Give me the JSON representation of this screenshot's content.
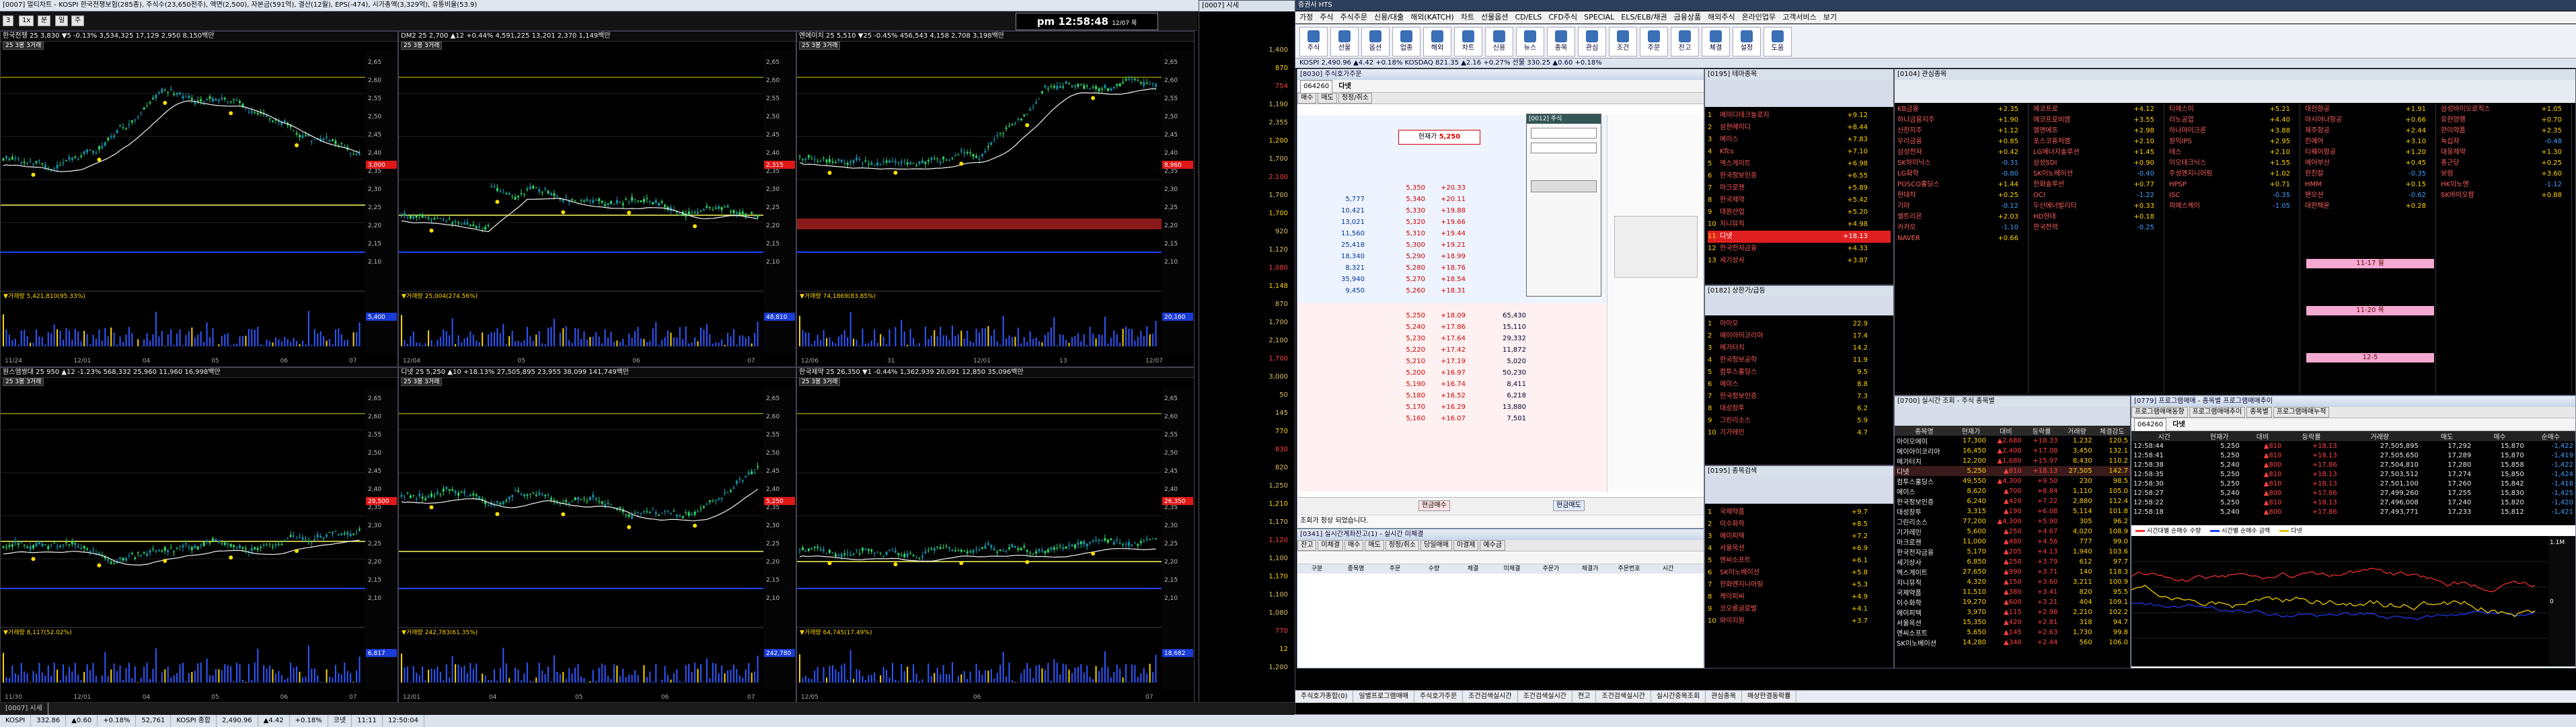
{
  "left_window": {
    "title": "[0007] 멀티차트 - KOSPI 한국전쟁보험(285종), 주식수(23,650천주), 액면(2,500), 자본금(591억), 결산(12월), EPS(-474), 시가총액(3,329억), 유통비율(53.9)",
    "clock": "pm 12:58:48",
    "clock_date": "12/07 목",
    "charts": [
      {
        "head": "한국전쟁 25  3,830  ▼5  -0.13%  3,534,325 17,129 2,950 8,150백만",
        "mode": "25  3봉  3거래",
        "price_tag": "3,000",
        "vol_label": "▼거래량 5,421,810(95.33%)",
        "vol_tag": "5,400",
        "dates": [
          "11/24",
          "12/01",
          "04",
          "05",
          "06",
          "07"
        ]
      },
      {
        "head": "DM2 25  2,700  ▲12  +0.44%  4,591,225 13,201 2,370 1,149백만",
        "mode": "25  3봉  3거래",
        "price_tag": "2,315",
        "vol_label": "▼거래량 25,004(274.56%)",
        "vol_tag": "48,810",
        "dates": [
          "12/04",
          "05",
          "06",
          "07"
        ]
      },
      {
        "head": "엔에이치 25  5,510  ▼25  -0.45%  456,543 4,158 2,708 3,198백만",
        "mode": "25  3봉  3거래",
        "price_tag": "8,960",
        "vol_label": "▼거래량 74,1869(83.85%)",
        "vol_tag": "20,160",
        "dates": [
          "12/06",
          "31",
          "12/01",
          "13",
          "12/07"
        ]
      },
      {
        "head": "원스엠쌍대 25  950  ▲12  -1.23%  568,332 25,960 11,960 16,998백만",
        "mode": "25  3봉  3거래",
        "price_tag": "29,500",
        "vol_label": "▼거래량 8,117(52.02%)",
        "vol_tag": "6,817",
        "dates": [
          "11/30",
          "12/01",
          "04",
          "05",
          "06",
          "07"
        ]
      },
      {
        "head": "디넷 25  5,250  ▲10  +18.13%  27,505,895 23,955 38,099 141,749백만",
        "mode": "25  3봉  3거래",
        "price_tag": "5,250",
        "vol_label": "▼거래량 242,783(61.35%)",
        "vol_tag": "242,780",
        "dates": [
          "12/01",
          "04",
          "05",
          "06",
          "07"
        ]
      },
      {
        "head": "한국제약 25  26,350  ▼1  -0.44%  1,362,939 20,091 12,850 35,096백만",
        "mode": "25  3봉  3거래",
        "price_tag": "26,350",
        "vol_label": "▼거래량 64,745(17.49%)",
        "vol_tag": "18,682",
        "dates": [
          "12/05",
          "06",
          "07"
        ]
      }
    ]
  },
  "narrow_column": {
    "header": "[0007] 시세",
    "values": [
      "1,400",
      "870",
      "754",
      "1,190",
      "2,355",
      "1,200",
      "1,700",
      "2,100",
      "1,700",
      "1,700",
      "920",
      "1,120",
      "1,080",
      "1,148",
      "870",
      "1,700",
      "2,100",
      "1,700",
      "3,000",
      "50",
      "145",
      "770",
      "830",
      "820",
      "1,250",
      "1,210",
      "1,170",
      "1,120",
      "1,100",
      "1,170",
      "1,100",
      "1,080",
      "770",
      "12",
      "1,200"
    ]
  },
  "main_app": {
    "title": "증권사 HTS",
    "menu": [
      "가정",
      "주식",
      "주식주문",
      "신용/대출",
      "해외(KATCH)",
      "차트",
      "선물옵션",
      "CD/ELS",
      "CFD주식",
      "SPECIAL",
      "ELS/ELB/채권",
      "금융상품",
      "해외주식",
      "온라인업무",
      "고객서비스",
      "보기"
    ],
    "toolbar": [
      "주식",
      "선물",
      "옵션",
      "업종",
      "해외",
      "차트",
      "신용",
      "뉴스",
      "종목",
      "관심",
      "조건",
      "주문",
      "잔고",
      "체결",
      "설정",
      "도움"
    ],
    "ticker": "KOSPI 2,490.96 ▲4.42 +0.18%   KOSDAQ 821.35 ▲2.16 +0.27%   선물 330.25 ▲0.60 +0.18%"
  },
  "order_window": {
    "title": "[8030] 주식호가주문",
    "code": "064260",
    "name": "다넷",
    "tabs": [
      "매수",
      "매도",
      "정정/취소"
    ],
    "price_label": "현재가",
    "current_price": "5,250",
    "asks": [
      {
        "qty": "",
        "price": "5,350",
        "pct": "+20.33"
      },
      {
        "qty": "5,777",
        "price": "5,340",
        "pct": "+20.11"
      },
      {
        "qty": "10,421",
        "price": "5,330",
        "pct": "+19.88"
      },
      {
        "qty": "13,021",
        "price": "5,320",
        "pct": "+19.66"
      },
      {
        "qty": "11,560",
        "price": "5,310",
        "pct": "+19.44"
      },
      {
        "qty": "25,418",
        "price": "5,300",
        "pct": "+19.21"
      },
      {
        "qty": "18,340",
        "price": "5,290",
        "pct": "+18.99"
      },
      {
        "qty": "8,321",
        "price": "5,280",
        "pct": "+18.76"
      },
      {
        "qty": "35,940",
        "price": "5,270",
        "pct": "+18.54"
      },
      {
        "qty": "9,450",
        "price": "5,260",
        "pct": "+18.31"
      }
    ],
    "bids": [
      {
        "price": "5,250",
        "pct": "+18.09",
        "qty": "65,430"
      },
      {
        "price": "5,240",
        "pct": "+17.86",
        "qty": "15,110"
      },
      {
        "price": "5,230",
        "pct": "+17.64",
        "qty": "29,332"
      },
      {
        "price": "5,220",
        "pct": "+17.42",
        "qty": "11,872"
      },
      {
        "price": "5,210",
        "pct": "+17.19",
        "qty": "5,020"
      },
      {
        "price": "5,200",
        "pct": "+16.97",
        "qty": "50,230"
      },
      {
        "price": "5,190",
        "pct": "+16.74",
        "qty": "8,411"
      },
      {
        "price": "5,180",
        "pct": "+16.52",
        "qty": "6,218"
      },
      {
        "price": "5,170",
        "pct": "+16.29",
        "qty": "13,880"
      },
      {
        "price": "5,160",
        "pct": "+16.07",
        "qty": "7,501"
      }
    ],
    "bottom_label": "조회가 정상 되었습니다.",
    "buy_btn": "현금매수",
    "sell_btn": "현금매도"
  },
  "realtime_window": {
    "title": "[0341] 실시간계좌잔고(1) - 실시간 미체결",
    "tabs": [
      "잔고",
      "미체결",
      "매수",
      "매도",
      "정정/취소",
      "당일매매",
      "미결제",
      "예수금"
    ],
    "cols": [
      "구분",
      "종목명",
      "주문",
      "수량",
      "체결",
      "미체결",
      "주문가",
      "체결가",
      "주문번호",
      "시간"
    ]
  },
  "themes": {
    "title": "[0195] 테마종목",
    "items": [
      {
        "name": "에이디테크놀로지",
        "chg": "+9.12"
      },
      {
        "name": "삼현에이디",
        "chg": "+8.44"
      },
      {
        "name": "에이스",
        "chg": "+7.83"
      },
      {
        "name": "KTcs",
        "chg": "+7.10"
      },
      {
        "name": "엑스게이트",
        "chg": "+6.98"
      },
      {
        "name": "한국정보인증",
        "chg": "+6.55"
      },
      {
        "name": "마크로젠",
        "chg": "+5.89"
      },
      {
        "name": "한국제약",
        "chg": "+5.42"
      },
      {
        "name": "대원산업",
        "chg": "+5.20"
      },
      {
        "name": "지니뮤직",
        "chg": "+4.98"
      },
      {
        "name": "디넷",
        "chg": "+18.13"
      },
      {
        "name": "한국전자금융",
        "chg": "+4.33"
      },
      {
        "name": "세기상사",
        "chg": "+3.87"
      }
    ]
  },
  "upper_list": {
    "title": "[0182] 상한가/급등",
    "items": [
      {
        "name": "아이오",
        "chg": "22.9"
      },
      {
        "name": "에이아이코리아",
        "chg": "17.4"
      },
      {
        "name": "메가터치",
        "chg": "14.2"
      },
      {
        "name": "한국정보공학",
        "chg": "11.9"
      },
      {
        "name": "컴투스홀딩스",
        "chg": "9.5"
      },
      {
        "name": "에이스",
        "chg": "8.8"
      },
      {
        "name": "한국정보인증",
        "chg": "7.3"
      },
      {
        "name": "대성창투",
        "chg": "6.2"
      },
      {
        "name": "그린리소스",
        "chg": "5.9"
      },
      {
        "name": "기가레인",
        "chg": "4.7"
      }
    ]
  },
  "mini_list": {
    "title": "[0195] 종목검색",
    "items": [
      {
        "name": "국제약품",
        "chg": "+9.7"
      },
      {
        "name": "이수화학",
        "chg": "+8.5"
      },
      {
        "name": "에이피텍",
        "chg": "+7.2"
      },
      {
        "name": "서울옥션",
        "chg": "+6.9"
      },
      {
        "name": "엔씨소프트",
        "chg": "+6.1"
      },
      {
        "name": "SK이노베이션",
        "chg": "+5.8"
      },
      {
        "name": "한화엔지니어링",
        "chg": "+5.3"
      },
      {
        "name": "케이피씨",
        "chg": "+4.9"
      },
      {
        "name": "코오롱글로벌",
        "chg": "+4.1"
      },
      {
        "name": "와이지원",
        "chg": "+3.7"
      }
    ]
  },
  "quote_board": {
    "title": "[0104] 관심종목",
    "columns": [
      {
        "items": [
          "KB금융",
          "하나금융지주",
          "신한지주",
          "우리금융",
          "삼성전자",
          "SK하이닉스",
          "LG화학",
          "POSCO홀딩스",
          "현대차",
          "기아",
          "셀트리온",
          "카카오",
          "NAVER"
        ],
        "vals": [
          "+2.35",
          "+1.90",
          "+1.12",
          "+0.85",
          "+0.42",
          "-0.31",
          "-0.80",
          "+1.44",
          "+0.25",
          "-0.12",
          "+2.03",
          "-1.10",
          "+0.66"
        ]
      },
      {
        "items": [
          "에코프로",
          "에코프로비엠",
          "엘앤에프",
          "포스코퓨처엠",
          "LG에너지솔루션",
          "삼성SDI",
          "SK이노베이션",
          "한화솔루션",
          "OCI",
          "두산에너빌리티",
          "HD현대",
          "한국전력"
        ],
        "vals": [
          "+4.12",
          "+3.55",
          "+2.98",
          "+2.10",
          "+1.45",
          "+0.90",
          "-0.40",
          "+0.77",
          "-1.22",
          "+0.33",
          "+0.18",
          "-0.25"
        ]
      },
      {
        "items": [
          "티에스이",
          "리노공업",
          "하나마이크론",
          "원익IPS",
          "테스",
          "이오테크닉스",
          "주성엔지니어링",
          "HPSP",
          "ISC",
          "피에스케이"
        ],
        "vals": [
          "+5.21",
          "+4.40",
          "+3.88",
          "+2.95",
          "+2.10",
          "+1.55",
          "+1.02",
          "+0.71",
          "-0.35",
          "-1.05"
        ]
      },
      {
        "items": [
          "대한항공",
          "아시아나항공",
          "제주항공",
          "진에어",
          "티웨이항공",
          "에어부산",
          "한진칼",
          "HMM",
          "팬오션",
          "대한해운"
        ],
        "vals": [
          "+1.91",
          "+0.66",
          "+2.44",
          "+3.10",
          "+1.20",
          "+0.45",
          "-0.35",
          "+0.15",
          "-0.62",
          "+0.28"
        ]
      },
      {
        "items": [
          "삼성바이오로직스",
          "유한양행",
          "한미약품",
          "녹십자",
          "대웅제약",
          "종근당",
          "보령",
          "HK이노엔",
          "SK바이오팜"
        ],
        "vals": [
          "+1.05",
          "+0.70",
          "+2.35",
          "-0.48",
          "+1.30",
          "+0.25",
          "+3.60",
          "-1.12",
          "+0.88"
        ]
      }
    ],
    "highlight_labels": [
      "11-17 월",
      "11-20 목",
      "12-5"
    ]
  },
  "program_table": {
    "title": "[0700] 실시간 조회 - 주식 종목별",
    "headers": [
      "종목명",
      "현재가",
      "대비",
      "등락률",
      "거래량",
      "체결강도"
    ],
    "rows": [
      {
        "name": "아이오에이",
        "price": "17,300",
        "chg": "▲2,680",
        "rate": "+18.33",
        "vol": "1,232",
        "str": "120.5"
      },
      {
        "name": "에이아이코리아",
        "price": "16,450",
        "chg": "▲2,400",
        "rate": "+17.08",
        "vol": "3,450",
        "str": "132.1"
      },
      {
        "name": "메가터치",
        "price": "12,200",
        "chg": "▲1,680",
        "rate": "+15.97",
        "vol": "8,430",
        "str": "110.2"
      },
      {
        "name": "디넷",
        "price": "5,250",
        "chg": "▲810",
        "rate": "+18.13",
        "vol": "27,505",
        "str": "142.7"
      },
      {
        "name": "컴투스홀딩스",
        "price": "49,550",
        "chg": "▲4,300",
        "rate": "+9.50",
        "vol": "230",
        "str": "98.5"
      },
      {
        "name": "에이스",
        "price": "8,620",
        "chg": "▲700",
        "rate": "+8.84",
        "vol": "1,110",
        "str": "105.0"
      },
      {
        "name": "한국정보인증",
        "price": "6,240",
        "chg": "▲420",
        "rate": "+7.22",
        "vol": "2,880",
        "str": "112.4"
      },
      {
        "name": "대성창투",
        "price": "3,315",
        "chg": "▲190",
        "rate": "+6.08",
        "vol": "5,114",
        "str": "101.8"
      },
      {
        "name": "그린리소스",
        "price": "77,200",
        "chg": "▲4,300",
        "rate": "+5.90",
        "vol": "305",
        "str": "96.2"
      },
      {
        "name": "기가레인",
        "price": "5,600",
        "chg": "▲250",
        "rate": "+4.67",
        "vol": "4,020",
        "str": "108.9"
      },
      {
        "name": "마크로젠",
        "price": "11,000",
        "chg": "▲480",
        "rate": "+4.56",
        "vol": "777",
        "str": "99.0"
      },
      {
        "name": "한국전자금융",
        "price": "5,170",
        "chg": "▲205",
        "rate": "+4.13",
        "vol": "1,940",
        "str": "103.6"
      },
      {
        "name": "세기상사",
        "price": "6,850",
        "chg": "▲250",
        "rate": "+3.79",
        "vol": "612",
        "str": "97.7"
      },
      {
        "name": "엑스게이트",
        "price": "27,650",
        "chg": "▲990",
        "rate": "+3.71",
        "vol": "140",
        "str": "118.3"
      },
      {
        "name": "지니뮤직",
        "price": "4,320",
        "chg": "▲150",
        "rate": "+3.60",
        "vol": "3,211",
        "str": "100.9"
      },
      {
        "name": "국제약품",
        "price": "11,510",
        "chg": "▲380",
        "rate": "+3.41",
        "vol": "820",
        "str": "95.5"
      },
      {
        "name": "이수화학",
        "price": "19,270",
        "chg": "▲600",
        "rate": "+3.21",
        "vol": "404",
        "str": "109.1"
      },
      {
        "name": "에이피텍",
        "price": "3,970",
        "chg": "▲115",
        "rate": "+2.98",
        "vol": "2,210",
        "str": "102.2"
      },
      {
        "name": "서울옥션",
        "price": "15,350",
        "chg": "▲420",
        "rate": "+2.81",
        "vol": "318",
        "str": "94.7"
      },
      {
        "name": "엔씨소프트",
        "price": "5,650",
        "chg": "▲145",
        "rate": "+2.63",
        "vol": "1,730",
        "str": "99.8"
      },
      {
        "name": "SK이노베이션",
        "price": "14,280",
        "chg": "▲340",
        "rate": "+2.44",
        "vol": "560",
        "str": "106.0"
      }
    ]
  },
  "program_window": {
    "title": "[0779] 프로그램매매 - 종목별 프로그램매매추이",
    "tabs": [
      "프로그램매매동향",
      "프로그램매매추이",
      "종목별",
      "프로그램매매누적"
    ],
    "code": "064260",
    "name": "다넷",
    "headers": [
      "시간",
      "현재가",
      "대비",
      "등락률",
      "거래량",
      "매도",
      "매수",
      "순매수"
    ],
    "rows": [
      [
        "12:58:44",
        "5,250",
        "▲810",
        "+18.13",
        "27,505,895",
        "17,292",
        "15,870",
        "-1,422"
      ],
      [
        "12:58:41",
        "5,250",
        "▲810",
        "+18.13",
        "27,505,650",
        "17,289",
        "15,870",
        "-1,419"
      ],
      [
        "12:58:38",
        "5,240",
        "▲800",
        "+17.86",
        "27,504,810",
        "17,280",
        "15,858",
        "-1,422"
      ],
      [
        "12:58:35",
        "5,250",
        "▲810",
        "+18.13",
        "27,503,512",
        "17,274",
        "15,850",
        "-1,424"
      ],
      [
        "12:58:30",
        "5,250",
        "▲810",
        "+18.13",
        "27,501,100",
        "17,260",
        "15,842",
        "-1,418"
      ],
      [
        "12:58:27",
        "5,240",
        "▲800",
        "+17.86",
        "27,499,260",
        "17,255",
        "15,830",
        "-1,425"
      ],
      [
        "12:58:22",
        "5,250",
        "▲810",
        "+18.13",
        "27,496,008",
        "17,240",
        "15,820",
        "-1,420"
      ],
      [
        "12:58:18",
        "5,240",
        "▲800",
        "+17.86",
        "27,493,771",
        "17,233",
        "15,812",
        "-1,421"
      ]
    ],
    "legend": [
      "시간대별 순매수 수량",
      "시간별 순매수 금액",
      "다넷"
    ],
    "scale_top": "1.1M",
    "scale_mid": "0"
  },
  "taskbar": {
    "items": [
      "주식호가종합(0)",
      "일별프로그램매매",
      "주식호가주문",
      "조건검색실시간",
      "조건검색실시간",
      "전고",
      "조건검색실시간",
      "실시간중목조회",
      "관심종목",
      "매상한결동락률"
    ],
    "status": [
      "KOSPI",
      "332.86",
      "▲0.60",
      "+0.18%",
      "52,761",
      "KOSPI 종합",
      "2,490.96",
      "▲4.42",
      "+0.18%",
      "코넷",
      "11:11",
      "12:50:04"
    ]
  }
}
